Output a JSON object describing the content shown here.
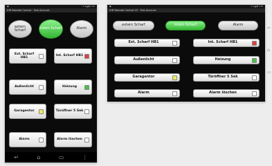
{
  "app": {
    "status_left": "▣",
    "status_right": "⊙ ▾◢ ▮ 7:25",
    "title_left": "IHR Remote Control · Test Account",
    "title_right": "IHR Remote Control V2 · Test Account"
  },
  "modes": [
    {
      "label": "extern Scharf",
      "active": false
    },
    {
      "label": "intern Scharf",
      "active": true
    },
    {
      "label": "Alarm",
      "active": false
    }
  ],
  "controls": [
    {
      "label": "Ext. Scharf HB1",
      "led": "#ffffff"
    },
    {
      "label": "Int. Scharf HB1",
      "led": "#e04040"
    },
    {
      "label": "Außenlicht",
      "led": "#ffffff"
    },
    {
      "label": "Heizung",
      "led": "#48c048"
    },
    {
      "label": "Garagentor",
      "led": "#ecec55"
    },
    {
      "label": "Türöffner 5 Sek",
      "led": "#ffffff"
    },
    {
      "label": "Alarm",
      "led": "#ffffff"
    },
    {
      "label": "Alarm löschen",
      "led": "#ffffff"
    }
  ],
  "nav": {
    "back_icon": "back-icon",
    "home_icon": "home-icon",
    "recents_icon": "recents-icon",
    "menu_icon": "menu-icon"
  }
}
